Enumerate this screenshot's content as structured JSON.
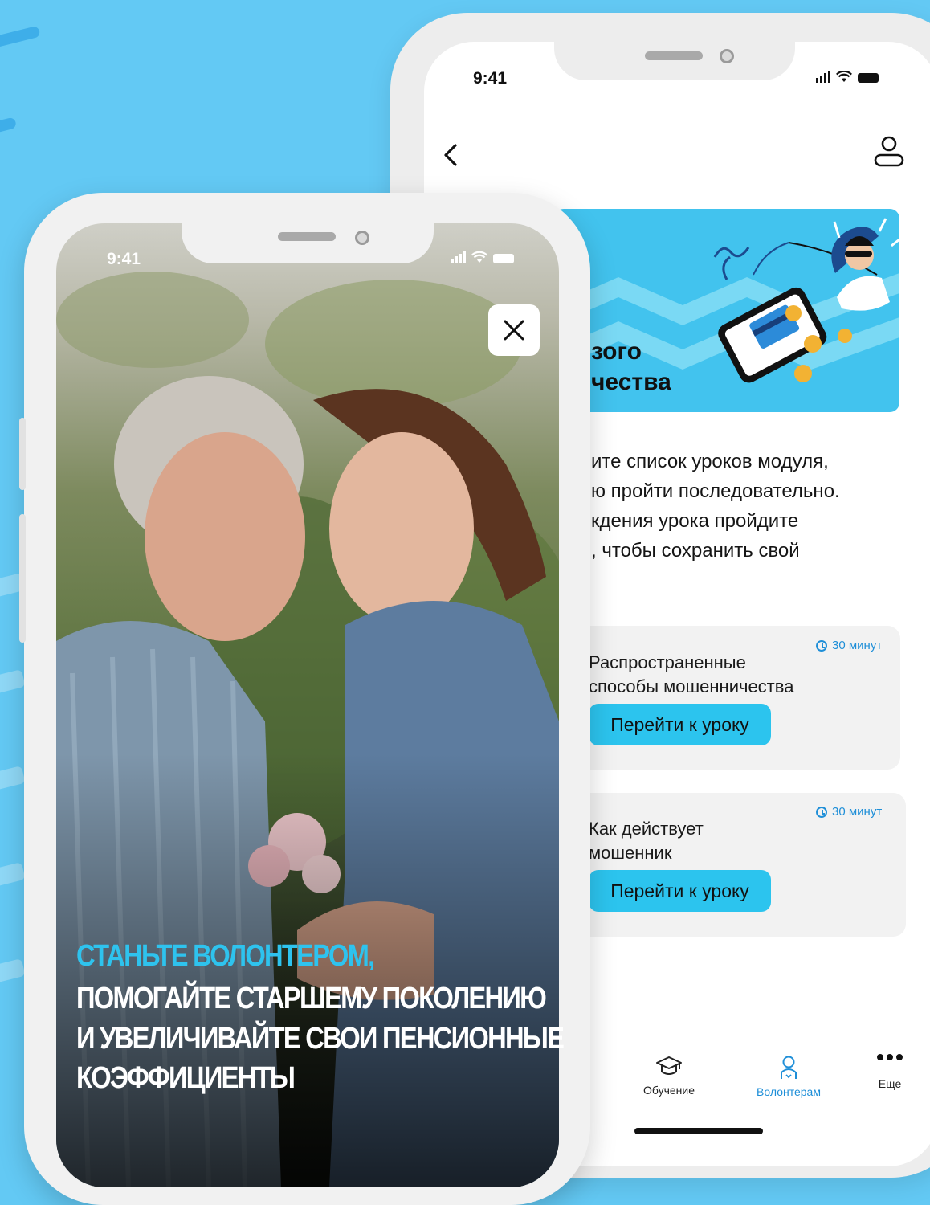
{
  "back_phone": {
    "status_time": "9:41",
    "banner_title_lines": [
      "зого",
      "чества"
    ],
    "description_lines": [
      "ите список уроков модуля,",
      "ю пройти последовательно.",
      "кдения урока пройдите",
      ", чтобы сохранить свой"
    ],
    "lessons": [
      {
        "title_lines": [
          "Распространенные",
          "способы мошенничества"
        ],
        "duration": "30 минут",
        "button_label": "Перейти к уроку"
      },
      {
        "title_lines": [
          "Как действует",
          "мошенник"
        ],
        "duration": "30 минут",
        "button_label": "Перейти к уроку"
      }
    ],
    "nav": [
      {
        "label": "Обучение",
        "icon": "graduation-cap-icon",
        "active": false
      },
      {
        "label": "Волонтерам",
        "icon": "volunteer-icon",
        "active": true
      },
      {
        "label": "Еще",
        "icon": "more-dots-icon",
        "active": false
      }
    ],
    "colors": {
      "accent": "#2cc4ee",
      "active_nav": "#1f8fd8",
      "card_bg": "#f2f2f2"
    }
  },
  "front_phone": {
    "status_time": "9:41",
    "close_icon": "close-icon",
    "headline": {
      "accent_line": "СТАНЬТЕ ВОЛОНТЕРОМ,",
      "lines": [
        "ПОМОГАЙТЕ СТАРШЕМУ ПОКОЛЕНИЮ",
        "И УВЕЛИЧИВАЙТЕ СВОИ ПЕНСИОННЫЕ",
        "КОЭФФИЦИЕНТЫ"
      ]
    },
    "colors": {
      "accent": "#2ec3ee",
      "text": "#ffffff"
    }
  },
  "background": {
    "color": "#63c9f4"
  }
}
